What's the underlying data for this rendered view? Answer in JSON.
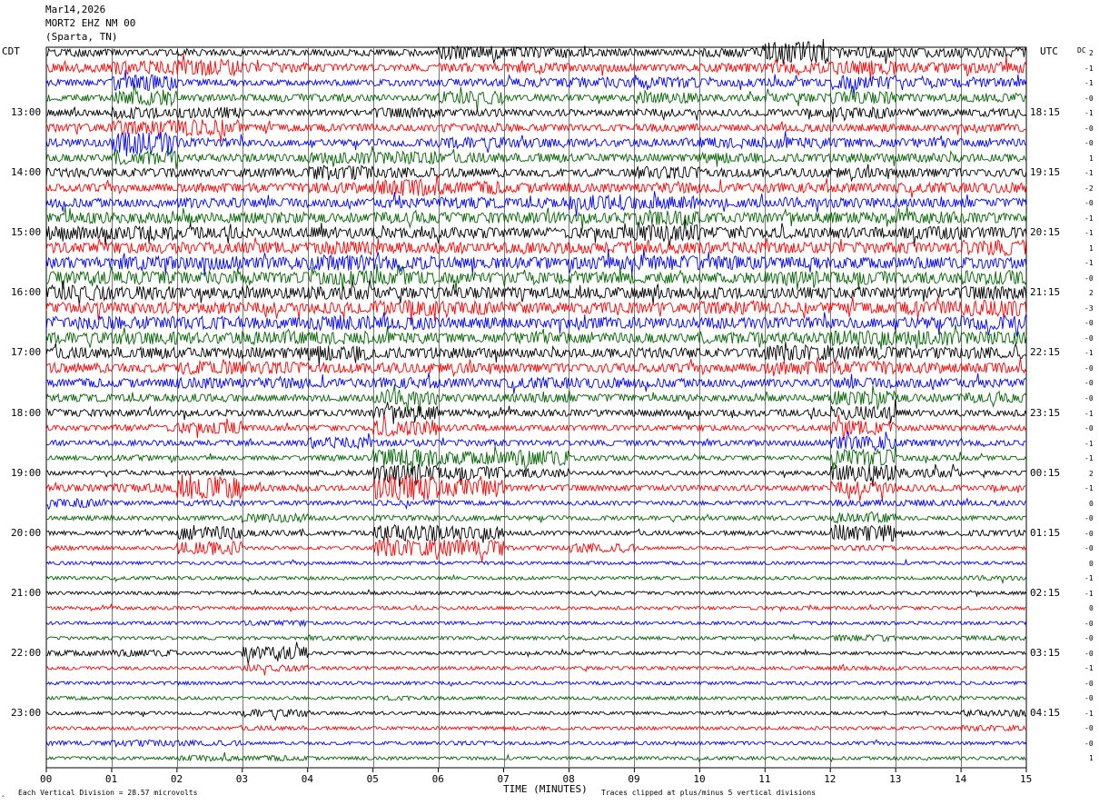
{
  "header": {
    "date": "Mar14,2026",
    "station": "MORT2 EHZ NM 00",
    "location": "(Sparta, TN)"
  },
  "left_axis_title": "CDT",
  "right_axis_title": "UTC",
  "dc_title": "DC",
  "footer": {
    "scale_note": "Each Vertical Division =   28.57 microvolts",
    "clip_note": "Traces clipped at plus/minus 5 vertical divisions"
  },
  "chart_data": {
    "type": "line",
    "title": "",
    "xlabel": "TIME (MINUTES)",
    "xlim": [
      0,
      15
    ],
    "x_ticks": [
      "00",
      "01",
      "02",
      "03",
      "04",
      "05",
      "06",
      "07",
      "08",
      "09",
      "10",
      "11",
      "12",
      "13",
      "14",
      "15"
    ],
    "grid": true,
    "trace_count": 48,
    "trace_interval_minutes": 15,
    "trace_colors": [
      "#000000",
      "#ff0000",
      "#0000ff",
      "#006400"
    ],
    "left_hour_labels": [
      {
        "row": 4,
        "label": "13:00"
      },
      {
        "row": 8,
        "label": "14:00"
      },
      {
        "row": 12,
        "label": "15:00"
      },
      {
        "row": 16,
        "label": "16:00"
      },
      {
        "row": 20,
        "label": "17:00"
      },
      {
        "row": 24,
        "label": "18:00"
      },
      {
        "row": 28,
        "label": "19:00"
      },
      {
        "row": 32,
        "label": "20:00"
      },
      {
        "row": 36,
        "label": "21:00"
      },
      {
        "row": 40,
        "label": "22:00"
      },
      {
        "row": 44,
        "label": "23:00"
      }
    ],
    "right_hour_labels": [
      {
        "row": 4,
        "label": "18:15"
      },
      {
        "row": 8,
        "label": "19:15"
      },
      {
        "row": 12,
        "label": "20:15"
      },
      {
        "row": 16,
        "label": "21:15"
      },
      {
        "row": 20,
        "label": "22:15"
      },
      {
        "row": 24,
        "label": "23:15"
      },
      {
        "row": 28,
        "label": "00:15"
      },
      {
        "row": 32,
        "label": "01:15"
      },
      {
        "row": 36,
        "label": "02:15"
      },
      {
        "row": 40,
        "label": "03:15"
      },
      {
        "row": 44,
        "label": "04:15"
      }
    ],
    "dc_offsets": [
      "2",
      "-1",
      "-1",
      "-0",
      "-1",
      "-0",
      "-0",
      "1",
      "-1",
      "-2",
      "-0",
      "-1",
      "-1",
      "1",
      "-1",
      "-0",
      "2",
      "-3",
      "-0",
      "-0",
      "-1",
      "-0",
      "-0",
      "-0",
      "-1",
      "-0",
      "-1",
      "-1",
      "2",
      "-1",
      "0",
      "-0",
      "-0",
      "-0",
      "0",
      "-1",
      "-1",
      "0",
      "-0",
      "-0",
      "-0",
      "-1",
      "-0",
      "-0",
      "-1",
      "-0",
      "-0",
      "1"
    ],
    "activity": [
      [
        0.7,
        0.6,
        0.6,
        0.5,
        0.6,
        0.6,
        1.2,
        1.0,
        0.7,
        0.6,
        0.8,
        2.0,
        1.0,
        0.8,
        0.9
      ],
      [
        0.8,
        1.2,
        1.5,
        0.9,
        0.7,
        0.6,
        0.8,
        0.9,
        0.7,
        0.6,
        0.8,
        1.0,
        1.3,
        0.9,
        1.0
      ],
      [
        0.6,
        1.4,
        0.6,
        0.5,
        0.5,
        0.6,
        0.7,
        0.8,
        1.0,
        1.0,
        0.7,
        0.7,
        1.3,
        0.8,
        0.8
      ],
      [
        0.6,
        1.5,
        0.6,
        0.7,
        0.7,
        0.6,
        1.2,
        0.6,
        0.6,
        1.0,
        0.6,
        0.8,
        1.1,
        0.7,
        0.8
      ],
      [
        0.6,
        1.0,
        1.0,
        0.6,
        0.6,
        0.9,
        0.7,
        0.6,
        0.6,
        0.7,
        0.6,
        0.7,
        1.0,
        0.7,
        0.7
      ],
      [
        0.7,
        1.3,
        1.5,
        0.6,
        0.7,
        0.6,
        0.8,
        0.7,
        0.6,
        0.7,
        0.6,
        0.7,
        0.7,
        0.6,
        0.7
      ],
      [
        0.7,
        2.0,
        0.8,
        0.6,
        0.6,
        0.7,
        1.0,
        0.9,
        0.7,
        0.7,
        1.0,
        1.0,
        0.9,
        0.8,
        0.7
      ],
      [
        0.7,
        1.2,
        0.7,
        0.7,
        1.0,
        1.2,
        0.9,
        0.8,
        0.7,
        0.7,
        0.9,
        0.8,
        0.8,
        0.8,
        0.7
      ],
      [
        0.8,
        0.8,
        0.7,
        0.8,
        1.3,
        0.9,
        0.8,
        0.7,
        0.7,
        1.2,
        0.8,
        0.8,
        0.9,
        0.8,
        0.7
      ],
      [
        0.7,
        0.7,
        0.8,
        0.8,
        1.0,
        1.5,
        1.2,
        0.9,
        0.8,
        1.0,
        0.8,
        0.9,
        0.8,
        0.9,
        0.9
      ],
      [
        0.8,
        0.7,
        0.9,
        0.8,
        0.7,
        0.9,
        1.0,
        0.9,
        1.3,
        1.2,
        0.8,
        0.8,
        0.9,
        0.8,
        0.8
      ],
      [
        1.0,
        1.0,
        0.9,
        1.0,
        0.8,
        1.0,
        1.0,
        1.0,
        1.0,
        1.4,
        0.9,
        0.9,
        1.0,
        1.0,
        0.9
      ],
      [
        1.2,
        1.3,
        1.0,
        0.9,
        1.0,
        1.0,
        1.0,
        0.9,
        1.0,
        1.5,
        1.0,
        1.0,
        1.0,
        1.2,
        1.0
      ],
      [
        1.0,
        1.0,
        1.0,
        1.0,
        1.2,
        1.0,
        1.0,
        1.0,
        1.0,
        1.0,
        1.0,
        1.0,
        1.0,
        1.0,
        1.4
      ],
      [
        1.0,
        1.2,
        1.2,
        1.0,
        1.4,
        1.2,
        1.0,
        1.0,
        1.2,
        1.3,
        1.2,
        1.0,
        1.0,
        1.0,
        1.0
      ],
      [
        1.2,
        1.2,
        1.2,
        1.0,
        1.3,
        1.2,
        1.0,
        1.0,
        1.0,
        1.0,
        1.0,
        1.2,
        1.2,
        1.0,
        1.4
      ],
      [
        1.4,
        1.2,
        1.0,
        1.0,
        1.2,
        1.0,
        1.0,
        1.0,
        1.0,
        1.0,
        1.0,
        1.0,
        1.0,
        1.0,
        1.2
      ],
      [
        1.0,
        1.0,
        1.0,
        1.0,
        1.0,
        1.4,
        1.2,
        1.0,
        1.0,
        0.9,
        1.2,
        1.0,
        0.9,
        1.2,
        1.5
      ],
      [
        1.2,
        1.2,
        1.2,
        1.0,
        1.4,
        1.2,
        1.0,
        0.9,
        1.0,
        0.9,
        1.0,
        1.0,
        0.9,
        1.0,
        1.3
      ],
      [
        1.0,
        1.2,
        1.0,
        1.2,
        1.2,
        1.0,
        0.9,
        1.0,
        0.9,
        0.9,
        1.0,
        1.0,
        1.4,
        1.2,
        1.2
      ],
      [
        1.0,
        1.0,
        0.9,
        1.0,
        1.3,
        1.0,
        0.9,
        0.8,
        0.8,
        0.9,
        0.8,
        1.4,
        1.2,
        1.0,
        1.0
      ],
      [
        0.9,
        0.8,
        1.2,
        1.2,
        0.9,
        0.9,
        0.9,
        0.8,
        0.8,
        0.8,
        0.8,
        1.2,
        1.2,
        1.0,
        0.9
      ],
      [
        0.8,
        0.8,
        1.0,
        1.0,
        0.8,
        1.0,
        0.8,
        1.0,
        0.9,
        0.8,
        0.7,
        0.7,
        0.9,
        0.8,
        0.8
      ],
      [
        0.7,
        0.7,
        0.7,
        0.6,
        0.6,
        1.2,
        0.7,
        0.8,
        0.7,
        0.6,
        0.6,
        0.6,
        1.3,
        0.7,
        0.9
      ],
      [
        0.7,
        0.6,
        0.6,
        0.6,
        0.6,
        1.2,
        0.6,
        0.6,
        0.6,
        0.6,
        0.6,
        0.6,
        1.2,
        0.6,
        0.6
      ],
      [
        0.5,
        0.6,
        1.0,
        0.5,
        0.5,
        1.5,
        0.6,
        0.5,
        0.5,
        0.5,
        0.5,
        0.5,
        1.3,
        0.5,
        0.5
      ],
      [
        0.5,
        0.5,
        0.5,
        0.5,
        1.0,
        0.6,
        0.6,
        0.5,
        0.5,
        0.5,
        0.5,
        0.5,
        1.2,
        0.6,
        0.5
      ],
      [
        0.4,
        0.5,
        0.4,
        0.4,
        0.5,
        1.6,
        1.2,
        1.4,
        0.5,
        0.4,
        0.4,
        0.4,
        1.5,
        0.5,
        0.4
      ],
      [
        0.4,
        0.4,
        0.4,
        0.4,
        0.5,
        1.5,
        1.2,
        0.8,
        0.4,
        0.4,
        0.4,
        0.4,
        1.5,
        0.8,
        0.4
      ],
      [
        0.6,
        0.8,
        2.0,
        0.6,
        0.5,
        2.2,
        1.6,
        0.6,
        0.5,
        0.5,
        0.5,
        0.5,
        1.2,
        0.6,
        0.5
      ],
      [
        0.8,
        0.4,
        0.5,
        0.4,
        0.4,
        0.5,
        0.4,
        0.4,
        0.4,
        0.4,
        0.4,
        0.4,
        0.6,
        0.6,
        0.5
      ],
      [
        0.4,
        0.4,
        0.4,
        0.8,
        0.4,
        0.5,
        0.5,
        0.4,
        0.4,
        0.4,
        0.4,
        0.4,
        0.9,
        0.4,
        0.4
      ],
      [
        0.4,
        0.4,
        1.2,
        0.6,
        0.4,
        1.5,
        1.2,
        0.4,
        0.4,
        0.4,
        0.4,
        0.4,
        1.5,
        0.4,
        0.6
      ],
      [
        0.4,
        0.3,
        1.2,
        0.3,
        0.3,
        1.5,
        1.5,
        0.4,
        0.8,
        0.3,
        0.3,
        0.3,
        0.5,
        0.3,
        0.3
      ],
      [
        0.3,
        0.3,
        0.3,
        0.3,
        0.3,
        0.3,
        0.3,
        0.3,
        0.3,
        0.3,
        0.3,
        0.3,
        0.3,
        0.3,
        0.3
      ],
      [
        0.3,
        0.3,
        0.3,
        0.3,
        0.3,
        0.3,
        0.3,
        0.3,
        0.3,
        0.3,
        0.3,
        0.3,
        0.3,
        0.3,
        0.4
      ],
      [
        0.3,
        0.3,
        0.3,
        0.3,
        0.3,
        0.3,
        0.3,
        0.3,
        0.3,
        0.3,
        0.3,
        0.3,
        0.3,
        0.3,
        0.3
      ],
      [
        0.3,
        0.3,
        0.3,
        0.3,
        0.3,
        0.3,
        0.3,
        0.3,
        0.3,
        0.3,
        0.3,
        0.3,
        0.3,
        0.3,
        0.3
      ],
      [
        0.3,
        0.3,
        0.3,
        0.5,
        0.3,
        0.3,
        0.3,
        0.3,
        0.3,
        0.3,
        0.3,
        0.3,
        0.3,
        0.3,
        0.3
      ],
      [
        0.3,
        0.3,
        0.3,
        0.3,
        0.4,
        0.3,
        0.3,
        0.3,
        0.3,
        0.3,
        0.3,
        0.3,
        0.6,
        0.3,
        0.4
      ],
      [
        0.5,
        0.6,
        0.3,
        1.2,
        0.3,
        0.3,
        0.3,
        0.3,
        0.3,
        0.3,
        0.3,
        0.3,
        0.3,
        0.3,
        0.3
      ],
      [
        0.3,
        0.3,
        0.3,
        0.6,
        0.3,
        0.3,
        0.3,
        0.3,
        0.3,
        0.3,
        0.3,
        0.3,
        0.4,
        0.3,
        0.3
      ],
      [
        0.3,
        0.3,
        0.3,
        0.3,
        0.3,
        0.3,
        0.3,
        0.3,
        0.3,
        0.3,
        0.3,
        0.3,
        0.3,
        0.3,
        0.3
      ],
      [
        0.3,
        0.3,
        0.3,
        0.3,
        0.3,
        0.4,
        0.3,
        0.3,
        0.3,
        0.3,
        0.3,
        0.3,
        0.3,
        0.4,
        0.3
      ],
      [
        0.3,
        0.3,
        0.3,
        0.7,
        0.3,
        0.3,
        0.3,
        0.3,
        0.3,
        0.3,
        0.3,
        0.3,
        0.3,
        0.3,
        0.6
      ],
      [
        0.3,
        0.3,
        0.3,
        0.4,
        0.3,
        0.3,
        0.3,
        0.3,
        0.3,
        0.3,
        0.3,
        0.3,
        0.3,
        0.3,
        0.5
      ],
      [
        0.4,
        0.6,
        0.5,
        0.3,
        0.3,
        0.3,
        0.4,
        0.3,
        0.3,
        0.3,
        0.3,
        0.3,
        0.3,
        0.3,
        0.3
      ],
      [
        0.3,
        0.3,
        0.5,
        0.5,
        0.3,
        0.3,
        0.3,
        0.3,
        0.3,
        0.3,
        0.3,
        0.3,
        0.3,
        0.3,
        0.3
      ]
    ]
  }
}
